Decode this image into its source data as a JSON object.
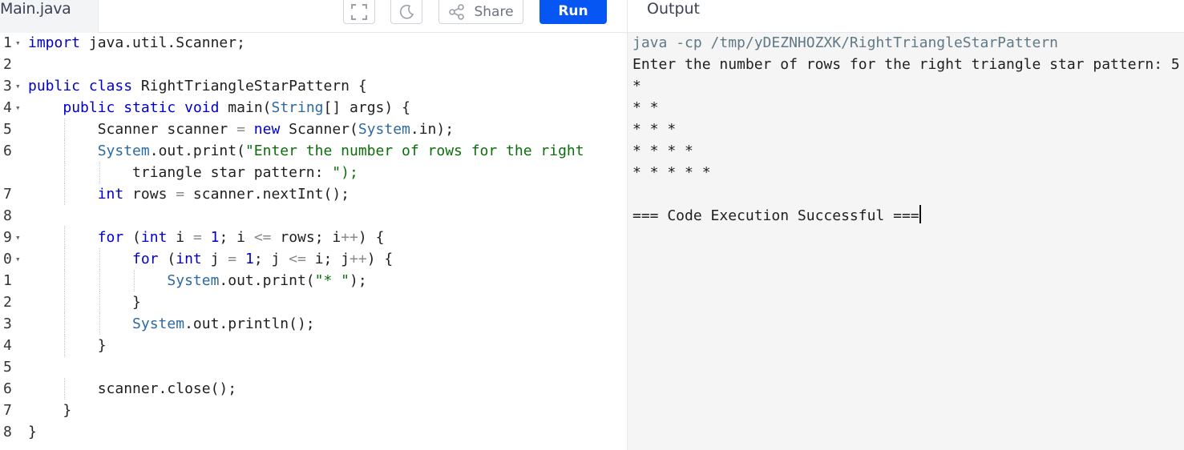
{
  "toolbar": {
    "file_name": "Main.java",
    "share_label": "Share",
    "run_label": "Run",
    "output_title": "Output",
    "icons": [
      "fullscreen-icon",
      "dark-mode-icon",
      "share-icon"
    ]
  },
  "editor": {
    "lines": [
      {
        "num": "1",
        "fold": true
      },
      {
        "num": "2",
        "fold": false
      },
      {
        "num": "3",
        "fold": true
      },
      {
        "num": "4",
        "fold": true
      },
      {
        "num": "5",
        "fold": false
      },
      {
        "num": "6",
        "fold": false
      },
      {
        "num": "",
        "fold": false
      },
      {
        "num": "7",
        "fold": false
      },
      {
        "num": "8",
        "fold": false
      },
      {
        "num": "9",
        "fold": true
      },
      {
        "num": "0",
        "fold": true
      },
      {
        "num": "1",
        "fold": false
      },
      {
        "num": "2",
        "fold": false
      },
      {
        "num": "3",
        "fold": false
      },
      {
        "num": "4",
        "fold": false
      },
      {
        "num": "5",
        "fold": false
      },
      {
        "num": "6",
        "fold": false
      },
      {
        "num": "7",
        "fold": false
      },
      {
        "num": "8",
        "fold": false
      }
    ],
    "code": [
      "import java.util.Scanner;",
      "",
      "public class RightTriangleStarPattern {",
      "    public static void main(String[] args) {",
      "        Scanner scanner = new Scanner(System.in);",
      "        System.out.print(\"Enter the number of rows for the right",
      "            triangle star pattern: \");",
      "        int rows = scanner.nextInt();",
      "",
      "        for (int i = 1; i <= rows; i++) {",
      "            for (int j = 1; j <= i; j++) {",
      "                System.out.print(\"* \");",
      "            }",
      "            System.out.println();",
      "        }",
      "",
      "        scanner.close();",
      "    }",
      "}"
    ]
  },
  "output": {
    "lines": [
      "java -cp /tmp/yDEZNHOZXK/RightTriangleStarPattern",
      "Enter the number of rows for the right triangle star pattern: 5",
      "*",
      "* *",
      "* * *",
      "* * * *",
      "* * * * *",
      "",
      "=== Code Execution Successful ==="
    ]
  },
  "colors": {
    "run_button": "#0556f3",
    "keyword": "#0000cc",
    "string": "#0b6e0b",
    "output_bg": "#f5f5f5"
  }
}
